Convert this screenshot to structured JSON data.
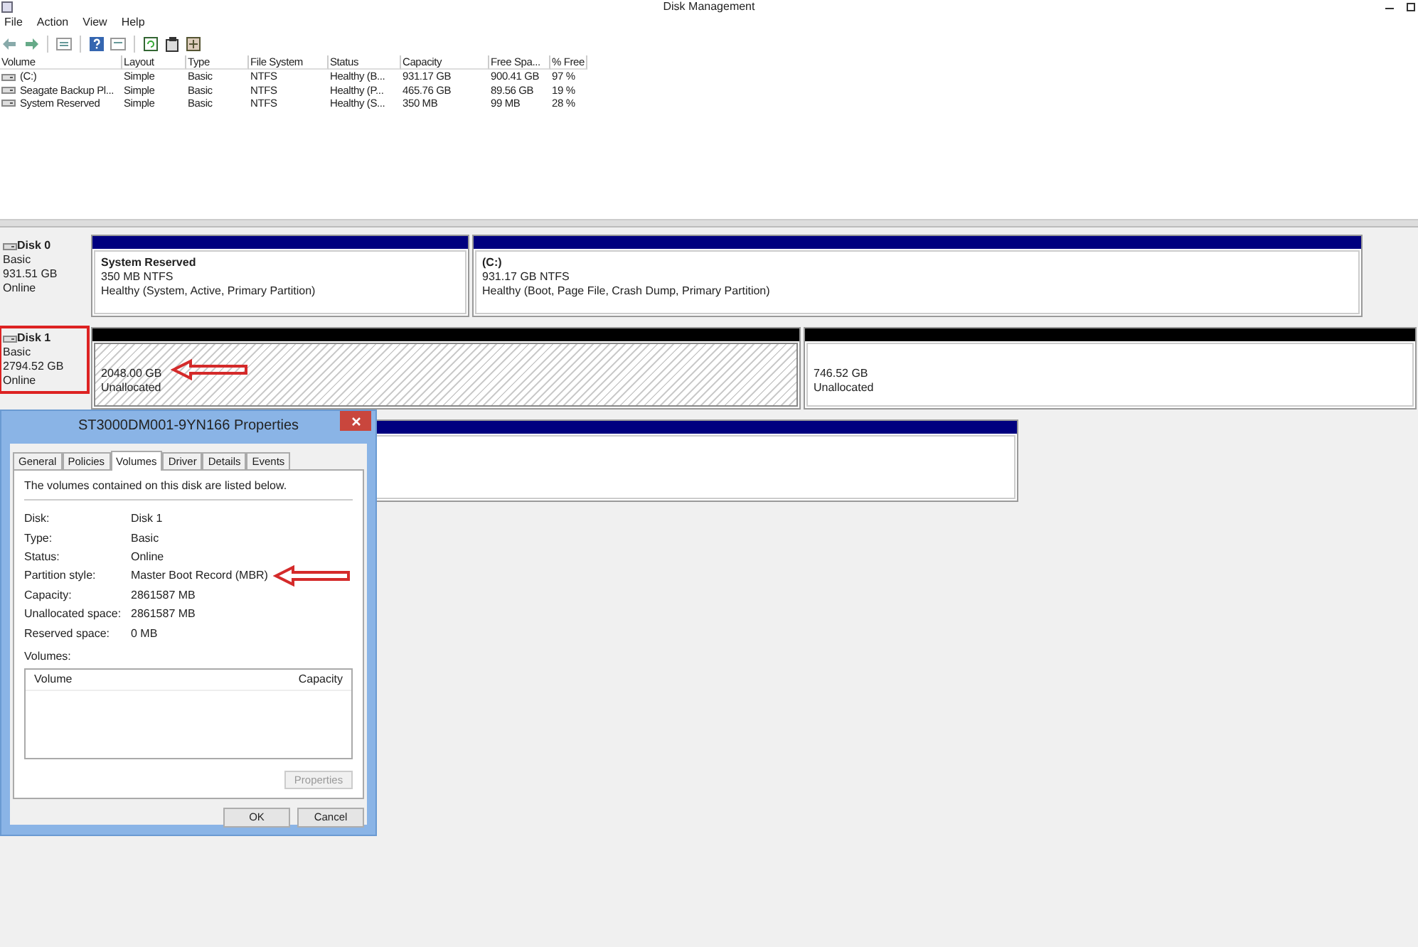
{
  "window": {
    "title": "Disk Management"
  },
  "menu": [
    "File",
    "Action",
    "View",
    "Help"
  ],
  "volume_table": {
    "columns": [
      "Volume",
      "Layout",
      "Type",
      "File System",
      "Status",
      "Capacity",
      "Free Spa...",
      "% Free"
    ],
    "rows": [
      [
        "(C:)",
        "Simple",
        "Basic",
        "NTFS",
        "Healthy (B...",
        "931.17 GB",
        "900.41 GB",
        "97 %"
      ],
      [
        "Seagate Backup Pl...",
        "Simple",
        "Basic",
        "NTFS",
        "Healthy (P...",
        "465.76 GB",
        "89.56 GB",
        "19 %"
      ],
      [
        "System Reserved",
        "Simple",
        "Basic",
        "NTFS",
        "Healthy (S...",
        "350 MB",
        "99 MB",
        "28 %"
      ]
    ]
  },
  "disks": [
    {
      "name": "Disk 0",
      "type": "Basic",
      "size": "931.51 GB",
      "state": "Online",
      "partitions": [
        {
          "kind": "primary",
          "selected": false,
          "title": "System Reserved",
          "size": "350 MB NTFS",
          "status": "Healthy (System, Active, Primary Partition)"
        },
        {
          "kind": "primary",
          "selected": false,
          "title": "(C:)",
          "size": "931.17 GB NTFS",
          "status": "Healthy (Boot, Page File, Crash Dump, Primary Partition)"
        }
      ]
    },
    {
      "name": "Disk 1",
      "type": "Basic",
      "size": "2794.52 GB",
      "state": "Online",
      "highlighted": true,
      "partitions": [
        {
          "kind": "unallocated",
          "selected": true,
          "annotated": true,
          "size": "2048.00 GB",
          "status": "Unallocated"
        },
        {
          "kind": "unallocated",
          "selected": false,
          "size": "746.52 GB",
          "status": "Unallocated"
        }
      ]
    },
    {
      "partitions": [
        {
          "kind": "primary",
          "selected": false
        }
      ]
    }
  ],
  "dialog": {
    "title": "ST3000DM001-9YN166 Properties",
    "tabs": [
      {
        "label": "General",
        "selected": false
      },
      {
        "label": "Policies",
        "selected": false
      },
      {
        "label": "Volumes",
        "selected": true
      },
      {
        "label": "Driver",
        "selected": false
      },
      {
        "label": "Details",
        "selected": false
      },
      {
        "label": "Events",
        "selected": false
      }
    ],
    "intro": "The volumes contained on this disk are listed below.",
    "info": [
      {
        "label": "Disk:",
        "value": "Disk 1"
      },
      {
        "label": "Type:",
        "value": "Basic"
      },
      {
        "label": "Status:",
        "value": "Online"
      },
      {
        "label": "Partition style:",
        "value": "Master Boot Record (MBR)",
        "annotated": true
      },
      {
        "label": "Capacity:",
        "value": "2861587 MB"
      },
      {
        "label": "Unallocated space:",
        "value": "2861587 MB"
      },
      {
        "label": "Reserved space:",
        "value": "0 MB"
      }
    ],
    "volumes_label": "Volumes:",
    "volume_columns": [
      "Volume",
      "Capacity"
    ],
    "properties_button": {
      "label": "Properties",
      "disabled": true
    },
    "buttons": [
      "OK",
      "Cancel"
    ]
  }
}
